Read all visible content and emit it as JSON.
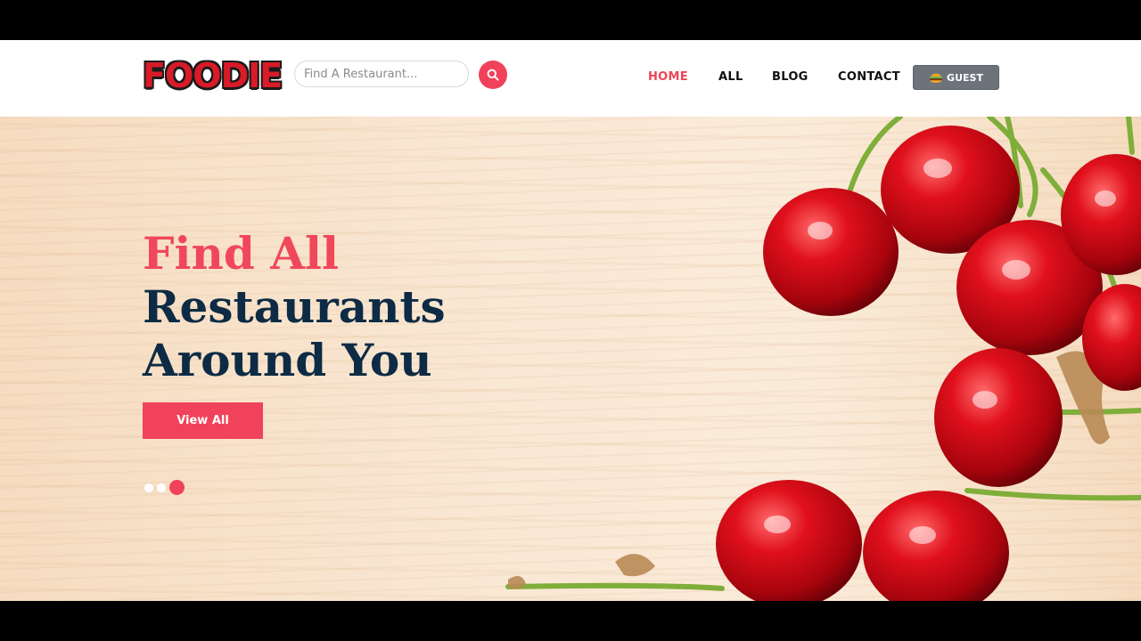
{
  "brand": {
    "logo_text": "FOODIE"
  },
  "search": {
    "placeholder": "Find A Restaurant..."
  },
  "nav": {
    "items": [
      {
        "label": "HOME",
        "active": true
      },
      {
        "label": "ALL",
        "active": false
      },
      {
        "label": "BLOG",
        "active": false
      },
      {
        "label": "CONTACT",
        "active": false
      }
    ],
    "guest_label": "GUEST",
    "guest_icon": "burger-icon"
  },
  "hero": {
    "title_line1": "Find All",
    "title_line2": "Restaurants",
    "title_line3": "Around You",
    "cta_label": "View All",
    "slides": {
      "count": 3,
      "active_index": 2
    }
  },
  "colors": {
    "accent": "#f0425a",
    "dark_text": "#0d2b44",
    "guest_button": "#6c737a"
  }
}
